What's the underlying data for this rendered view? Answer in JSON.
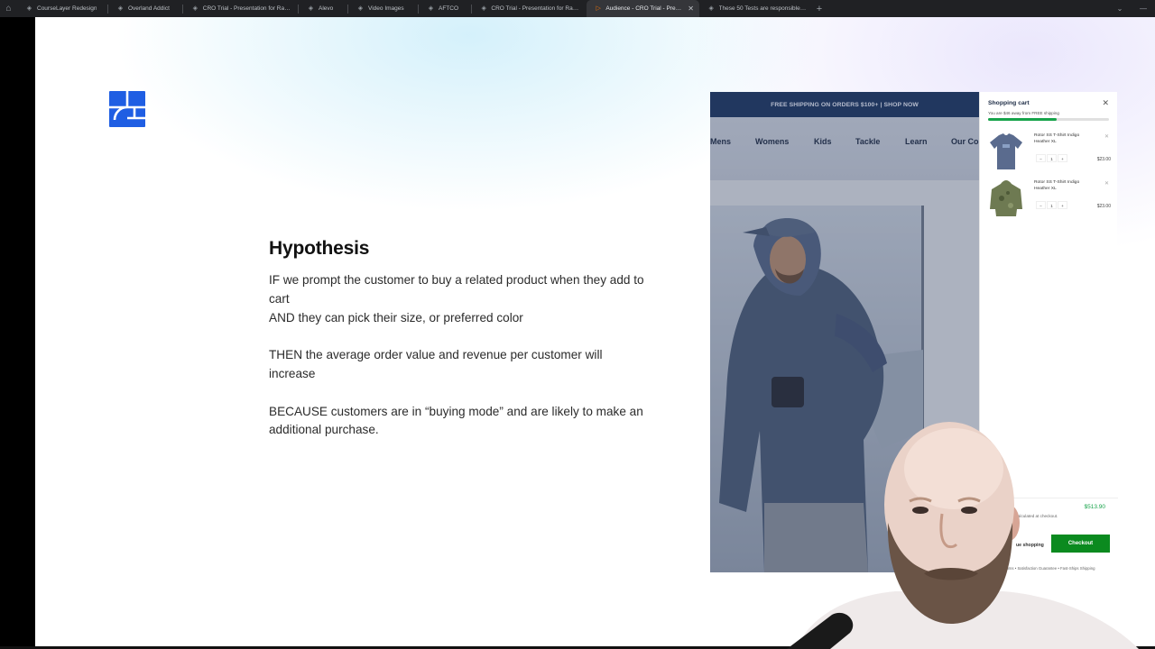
{
  "browser": {
    "tabs": [
      {
        "label": "CourseLayer Redesign",
        "icon": "webflow-icon"
      },
      {
        "label": "Overland Addict",
        "icon": "webflow-icon"
      },
      {
        "label": "CRO Trial - Presentation for Ramraj",
        "icon": "webflow-icon"
      },
      {
        "label": "Alevo",
        "icon": "webflow-icon"
      },
      {
        "label": "Video Images",
        "icon": "webflow-icon"
      },
      {
        "label": "AFTCO",
        "icon": "webflow-icon"
      },
      {
        "label": "CRO Trial - Presentation for Ramraj (t",
        "icon": "webflow-icon"
      },
      {
        "label": "Audience - CRO Trial - Presentati",
        "icon": "play-icon",
        "active": true
      },
      {
        "label": "These 50 Tests are responsible for €",
        "icon": "webflow-icon"
      }
    ],
    "new_tab_label": "+",
    "close_label": "✕",
    "menu_label": "⌄",
    "minimize_label": "—"
  },
  "slide": {
    "title": "Hypothesis",
    "if_line": "IF we prompt the customer to buy a related product when they add to cart",
    "and_line": "AND they can pick their size, or preferred color",
    "then_line": "THEN the average order value and revenue per customer will increase",
    "because_line": "BECAUSE customers are in “buying mode” and are likely to make an additional purchase."
  },
  "store": {
    "banner": "FREE SHIPPING ON ORDERS $100+ | SHOP NOW",
    "nav": [
      "Mens",
      "Womens",
      "Kids",
      "Tackle",
      "Learn",
      "Our Co"
    ]
  },
  "cart": {
    "title": "Shopping cart",
    "close": "✕",
    "shipping_note": "You are $46 away from FREE shipping",
    "progress_fraction": 0.57,
    "items": [
      {
        "name": "Rotor SS T-Shirt Indigo Heather XL",
        "qty": "1",
        "minus": "−",
        "plus": "+",
        "price": "$23.00",
        "remove": "✕"
      },
      {
        "name": "Rotor SS T-Shirt Indigo Heather XL",
        "qty": "1",
        "minus": "−",
        "plus": "+",
        "price": "$23.00",
        "remove": "✕"
      }
    ],
    "total": "$513.90",
    "tax_note": "s calculated at checkout.",
    "continue_label": "ue shopping",
    "checkout_label": "Checkout",
    "trust_line": "turns • Satisfaction Guarantee • Fast-Ships Shipping"
  },
  "colors": {
    "logo_blue": "#1f5ee3",
    "banner_navy": "#1f3a66",
    "checkout_green": "#0b8a1f"
  }
}
